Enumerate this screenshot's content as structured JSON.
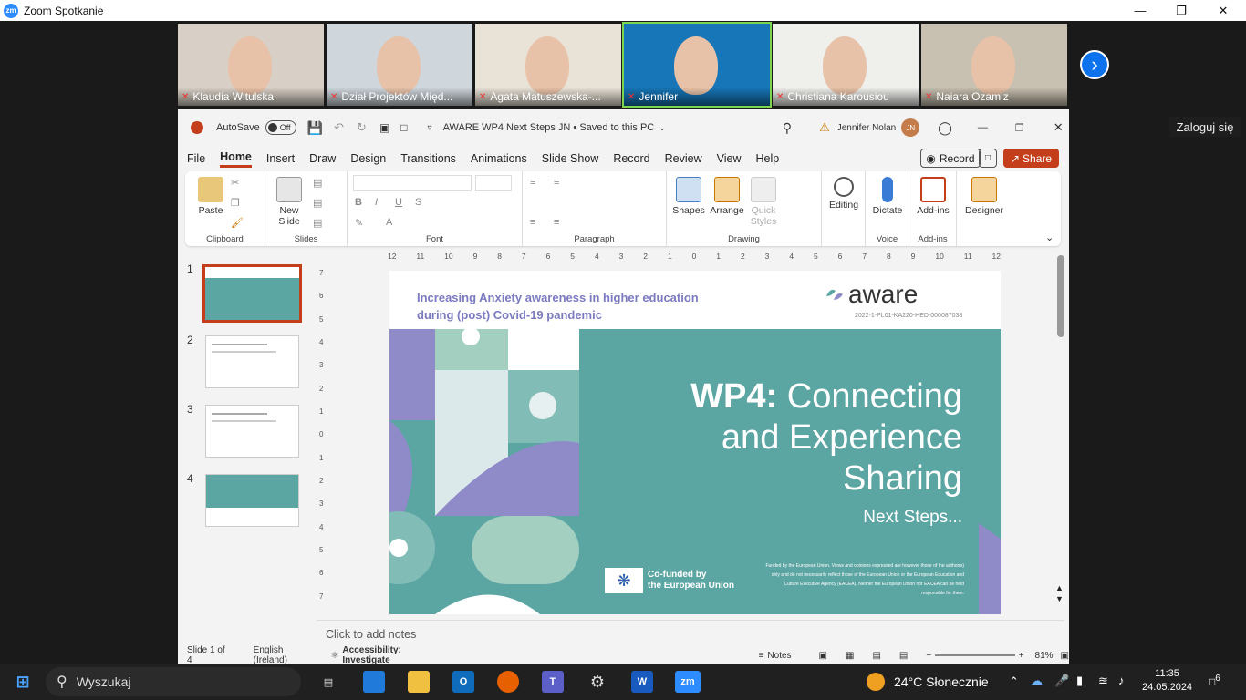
{
  "window": {
    "title": "Zoom Spotkanie",
    "logo": "zm",
    "login_label": "Zaloguj się"
  },
  "participants": [
    {
      "name": "Klaudia Witulska",
      "bg": "#d8d0c6"
    },
    {
      "name": "Dział Projektów Międ...",
      "bg": "#cfd6dc"
    },
    {
      "name": "Agata Matuszewska-...",
      "bg": "#e9e2d6"
    },
    {
      "name": "Jennifer",
      "bg": "#1676b8"
    },
    {
      "name": "Christiana Karousiou",
      "bg": "#efefec"
    },
    {
      "name": "Naiara Ozamiz",
      "bg": "#c8c0b0"
    }
  ],
  "ppt": {
    "autosave_label": "AutoSave",
    "autosave_state": "Off",
    "doc_title": "AWARE WP4 Next Steps JN • Saved to this PC",
    "user": "Jennifer Nolan",
    "initials": "JN",
    "menu": [
      "File",
      "Home",
      "Insert",
      "Draw",
      "Design",
      "Transitions",
      "Animations",
      "Slide Show",
      "Record",
      "Review",
      "View",
      "Help"
    ],
    "record_label": "Record",
    "share_label": "Share",
    "ribbon": {
      "paste": "Paste",
      "new_slide": "New Slide",
      "shapes": "Shapes",
      "arrange": "Arrange",
      "quick_styles": "Quick Styles",
      "editing": "Editing",
      "dictate": "Dictate",
      "addins": "Add-ins",
      "designer": "Designer",
      "groups": [
        "Clipboard",
        "Slides",
        "Font",
        "Paragraph",
        "Drawing",
        "Voice",
        "Add-ins"
      ]
    },
    "ruler": [
      "12",
      "11",
      "10",
      "9",
      "8",
      "7",
      "6",
      "5",
      "4",
      "3",
      "2",
      "1",
      "0",
      "1",
      "2",
      "3",
      "4",
      "5",
      "6",
      "7",
      "8",
      "9",
      "10",
      "11",
      "12"
    ],
    "vruler": [
      "7",
      "6",
      "5",
      "4",
      "3",
      "2",
      "1",
      "0",
      "1",
      "2",
      "3",
      "4",
      "5",
      "6",
      "7"
    ],
    "slide_numbers": [
      "1",
      "2",
      "3",
      "4"
    ],
    "slide": {
      "subtitle_line1": "Increasing Anxiety awareness in higher education",
      "subtitle_line2": "during (post) Covid-19 pandemic",
      "logo": "aware",
      "grant": "2022-1-PL01-KA220-HED-000087038",
      "title_bold": "WP4:",
      "title_line1": " Connecting",
      "title_line2": "and Experience",
      "title_line3": "Sharing",
      "next": "Next Steps...",
      "eu_line1": "Co-funded by",
      "eu_line2": "the European Union",
      "disclaimer": "Funded by the European Union. Views and opinions expressed are however those of the author(s) only and do not necessarily reflect those of the European Union or the European Education and Culture Executive Agency (EACEA). Neither the European Union nor EACEA can be held responsible for them."
    },
    "notes_placeholder": "Click to add notes",
    "status": {
      "slide": "Slide 1 of 4",
      "lang": "English (Ireland)",
      "accessibility": "Accessibility: Investigate",
      "notes": "Notes",
      "zoom": "81%"
    }
  },
  "taskbar": {
    "search": "Wyszukaj",
    "weather": "24°C  Słonecznie",
    "time": "11:35",
    "date": "24.05.2024",
    "notif": "6"
  },
  "colors": {
    "accent": "#c43e1c",
    "teal": "#5ba5a3",
    "purple": "#8f8bc9",
    "zoom_blue": "#0e72ed"
  }
}
